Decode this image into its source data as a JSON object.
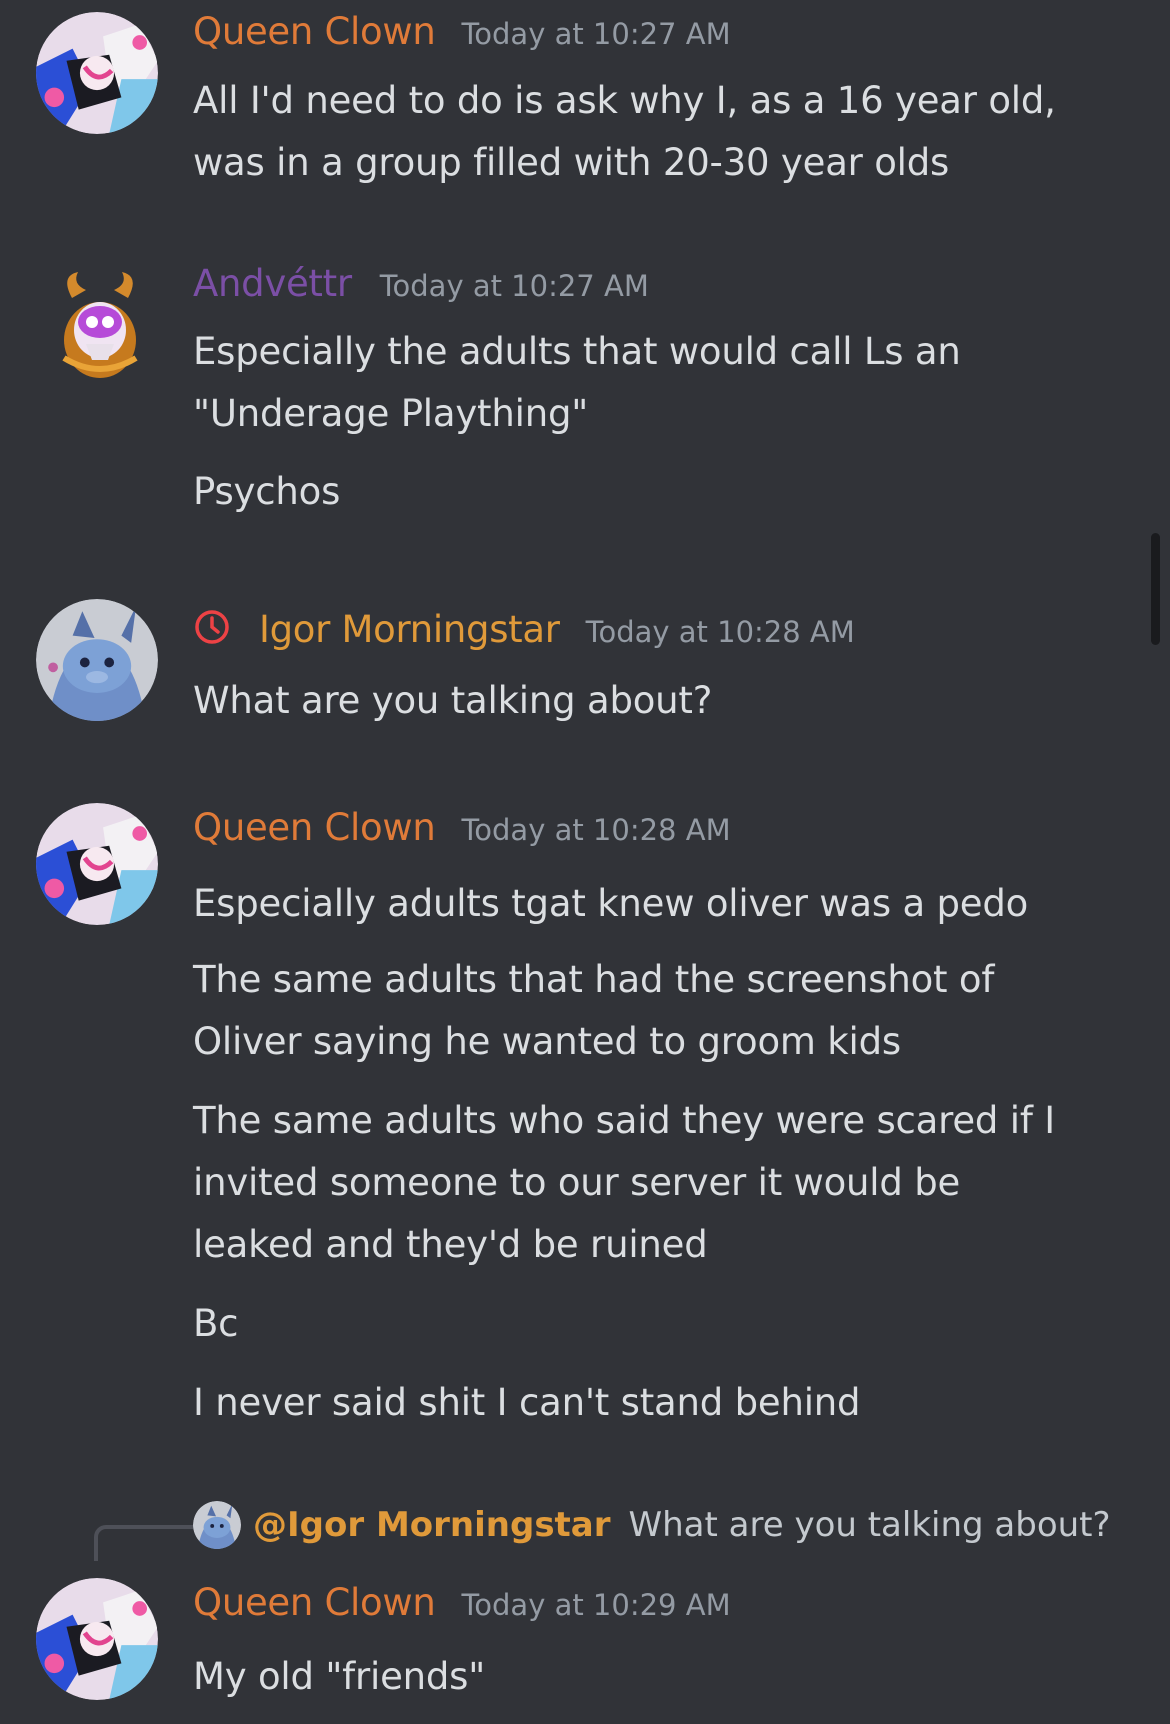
{
  "colors": {
    "background": "#313338",
    "queen_clown": "#e07b39",
    "andvettr": "#7b4fa6",
    "igor": "#e09a3a",
    "timestamp": "#949ba4",
    "text": "#dbdee1",
    "timeout": "#ed4245"
  },
  "messages": [
    {
      "author": "Queen Clown",
      "timestamp": "Today at 10:27 AM",
      "avatar_icon": "queen-clown-avatar",
      "lines": [
        "All I'd need to do is ask why I, as a 16 year old,",
        "was in a group filled with 20-30 year olds"
      ]
    },
    {
      "author": "Andvéttr",
      "timestamp": "Today at 10:27 AM",
      "avatar_icon": "andvettr-avatar",
      "lines": [
        "Especially the adults that would call Ls an",
        "\"Underage Plaything\"",
        "Psychos"
      ]
    },
    {
      "author": "Igor Morningstar",
      "timestamp": "Today at 10:28 AM",
      "avatar_icon": "igor-avatar",
      "badge_icon": "timeout-clock-icon",
      "lines": [
        "What are you talking about?"
      ]
    },
    {
      "author": "Queen Clown",
      "timestamp": "Today at 10:28 AM",
      "avatar_icon": "queen-clown-avatar",
      "lines": [
        "Especially adults tgat knew oliver was a pedo",
        "The same adults that had the screenshot of",
        "Oliver saying he wanted to groom kids",
        "The same adults who said they were scared if I",
        "invited someone to our server it would be",
        "leaked and they'd be ruined",
        "Bc",
        "I never said shit I can't stand behind"
      ]
    },
    {
      "author": "Queen Clown",
      "timestamp": "Today at 10:29 AM",
      "avatar_icon": "queen-clown-avatar",
      "reply": {
        "mention": "@Igor Morningstar",
        "text": "What are you talking about?"
      },
      "lines": [
        "My old \"friends\""
      ]
    }
  ]
}
